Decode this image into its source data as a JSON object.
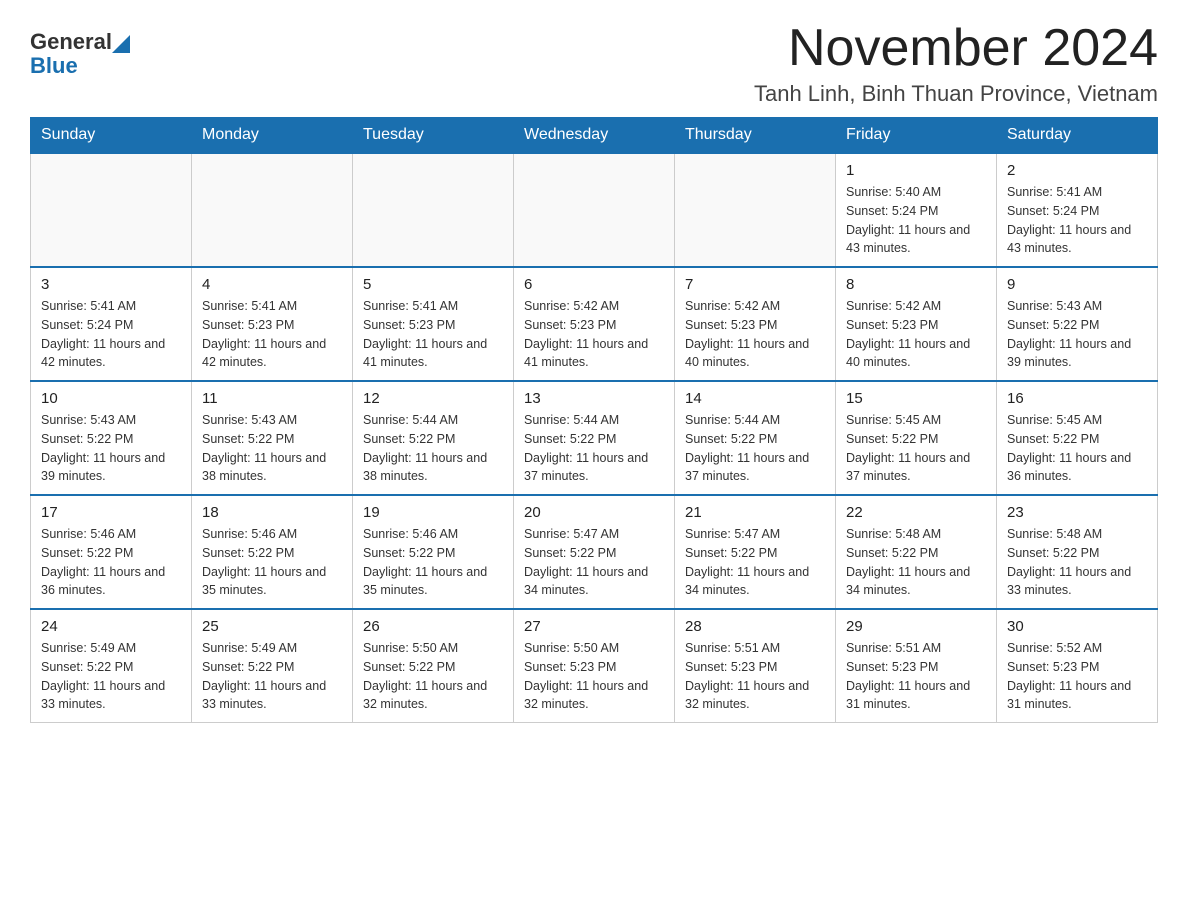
{
  "header": {
    "logo_general": "General",
    "logo_blue": "Blue",
    "month_title": "November 2024",
    "location": "Tanh Linh, Binh Thuan Province, Vietnam"
  },
  "weekdays": [
    "Sunday",
    "Monday",
    "Tuesday",
    "Wednesday",
    "Thursday",
    "Friday",
    "Saturday"
  ],
  "weeks": [
    [
      {
        "day": "",
        "info": ""
      },
      {
        "day": "",
        "info": ""
      },
      {
        "day": "",
        "info": ""
      },
      {
        "day": "",
        "info": ""
      },
      {
        "day": "",
        "info": ""
      },
      {
        "day": "1",
        "info": "Sunrise: 5:40 AM\nSunset: 5:24 PM\nDaylight: 11 hours and 43 minutes."
      },
      {
        "day": "2",
        "info": "Sunrise: 5:41 AM\nSunset: 5:24 PM\nDaylight: 11 hours and 43 minutes."
      }
    ],
    [
      {
        "day": "3",
        "info": "Sunrise: 5:41 AM\nSunset: 5:24 PM\nDaylight: 11 hours and 42 minutes."
      },
      {
        "day": "4",
        "info": "Sunrise: 5:41 AM\nSunset: 5:23 PM\nDaylight: 11 hours and 42 minutes."
      },
      {
        "day": "5",
        "info": "Sunrise: 5:41 AM\nSunset: 5:23 PM\nDaylight: 11 hours and 41 minutes."
      },
      {
        "day": "6",
        "info": "Sunrise: 5:42 AM\nSunset: 5:23 PM\nDaylight: 11 hours and 41 minutes."
      },
      {
        "day": "7",
        "info": "Sunrise: 5:42 AM\nSunset: 5:23 PM\nDaylight: 11 hours and 40 minutes."
      },
      {
        "day": "8",
        "info": "Sunrise: 5:42 AM\nSunset: 5:23 PM\nDaylight: 11 hours and 40 minutes."
      },
      {
        "day": "9",
        "info": "Sunrise: 5:43 AM\nSunset: 5:22 PM\nDaylight: 11 hours and 39 minutes."
      }
    ],
    [
      {
        "day": "10",
        "info": "Sunrise: 5:43 AM\nSunset: 5:22 PM\nDaylight: 11 hours and 39 minutes."
      },
      {
        "day": "11",
        "info": "Sunrise: 5:43 AM\nSunset: 5:22 PM\nDaylight: 11 hours and 38 minutes."
      },
      {
        "day": "12",
        "info": "Sunrise: 5:44 AM\nSunset: 5:22 PM\nDaylight: 11 hours and 38 minutes."
      },
      {
        "day": "13",
        "info": "Sunrise: 5:44 AM\nSunset: 5:22 PM\nDaylight: 11 hours and 37 minutes."
      },
      {
        "day": "14",
        "info": "Sunrise: 5:44 AM\nSunset: 5:22 PM\nDaylight: 11 hours and 37 minutes."
      },
      {
        "day": "15",
        "info": "Sunrise: 5:45 AM\nSunset: 5:22 PM\nDaylight: 11 hours and 37 minutes."
      },
      {
        "day": "16",
        "info": "Sunrise: 5:45 AM\nSunset: 5:22 PM\nDaylight: 11 hours and 36 minutes."
      }
    ],
    [
      {
        "day": "17",
        "info": "Sunrise: 5:46 AM\nSunset: 5:22 PM\nDaylight: 11 hours and 36 minutes."
      },
      {
        "day": "18",
        "info": "Sunrise: 5:46 AM\nSunset: 5:22 PM\nDaylight: 11 hours and 35 minutes."
      },
      {
        "day": "19",
        "info": "Sunrise: 5:46 AM\nSunset: 5:22 PM\nDaylight: 11 hours and 35 minutes."
      },
      {
        "day": "20",
        "info": "Sunrise: 5:47 AM\nSunset: 5:22 PM\nDaylight: 11 hours and 34 minutes."
      },
      {
        "day": "21",
        "info": "Sunrise: 5:47 AM\nSunset: 5:22 PM\nDaylight: 11 hours and 34 minutes."
      },
      {
        "day": "22",
        "info": "Sunrise: 5:48 AM\nSunset: 5:22 PM\nDaylight: 11 hours and 34 minutes."
      },
      {
        "day": "23",
        "info": "Sunrise: 5:48 AM\nSunset: 5:22 PM\nDaylight: 11 hours and 33 minutes."
      }
    ],
    [
      {
        "day": "24",
        "info": "Sunrise: 5:49 AM\nSunset: 5:22 PM\nDaylight: 11 hours and 33 minutes."
      },
      {
        "day": "25",
        "info": "Sunrise: 5:49 AM\nSunset: 5:22 PM\nDaylight: 11 hours and 33 minutes."
      },
      {
        "day": "26",
        "info": "Sunrise: 5:50 AM\nSunset: 5:22 PM\nDaylight: 11 hours and 32 minutes."
      },
      {
        "day": "27",
        "info": "Sunrise: 5:50 AM\nSunset: 5:23 PM\nDaylight: 11 hours and 32 minutes."
      },
      {
        "day": "28",
        "info": "Sunrise: 5:51 AM\nSunset: 5:23 PM\nDaylight: 11 hours and 32 minutes."
      },
      {
        "day": "29",
        "info": "Sunrise: 5:51 AM\nSunset: 5:23 PM\nDaylight: 11 hours and 31 minutes."
      },
      {
        "day": "30",
        "info": "Sunrise: 5:52 AM\nSunset: 5:23 PM\nDaylight: 11 hours and 31 minutes."
      }
    ]
  ]
}
